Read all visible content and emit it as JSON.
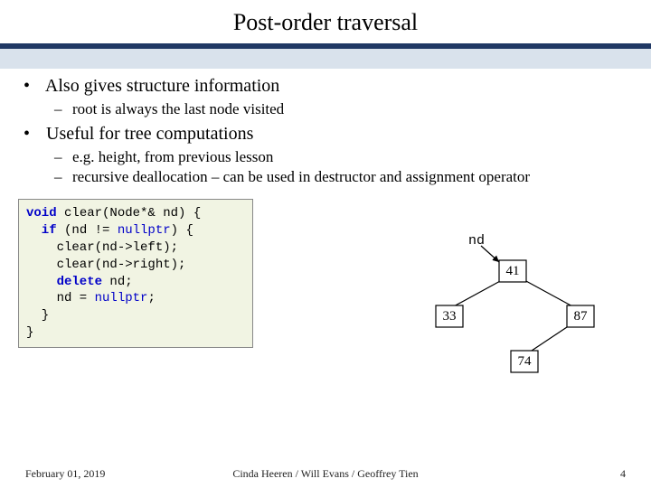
{
  "title": "Post-order traversal",
  "bullets": {
    "b1": "Also gives structure information",
    "b1_sub": [
      "root is always the last node visited"
    ],
    "b2": "Useful for tree computations",
    "b2_sub": [
      "e.g. height, from previous lesson",
      "recursive deallocation – can be used in destructor and assignment operator"
    ]
  },
  "code": {
    "l1a": "void",
    "l1b": " clear(Node*& nd) {",
    "l2a": "  if",
    "l2b": " (nd != ",
    "l2c": "nullptr",
    "l2d": ") {",
    "l3": "    clear(nd->left);",
    "l4": "    clear(nd->right);",
    "l5a": "    delete",
    "l5b": " nd;",
    "l6a": "    nd = ",
    "l6b": "nullptr",
    "l6c": ";",
    "l7": "  }",
    "l8": "}"
  },
  "tree": {
    "pointer_label": "nd",
    "nodes": {
      "root": "41",
      "left": "33",
      "right": "87",
      "rl": "74"
    }
  },
  "footer": {
    "date": "February 01, 2019",
    "authors": "Cinda Heeren / Will Evans / Geoffrey Tien",
    "pagenum": "4"
  }
}
